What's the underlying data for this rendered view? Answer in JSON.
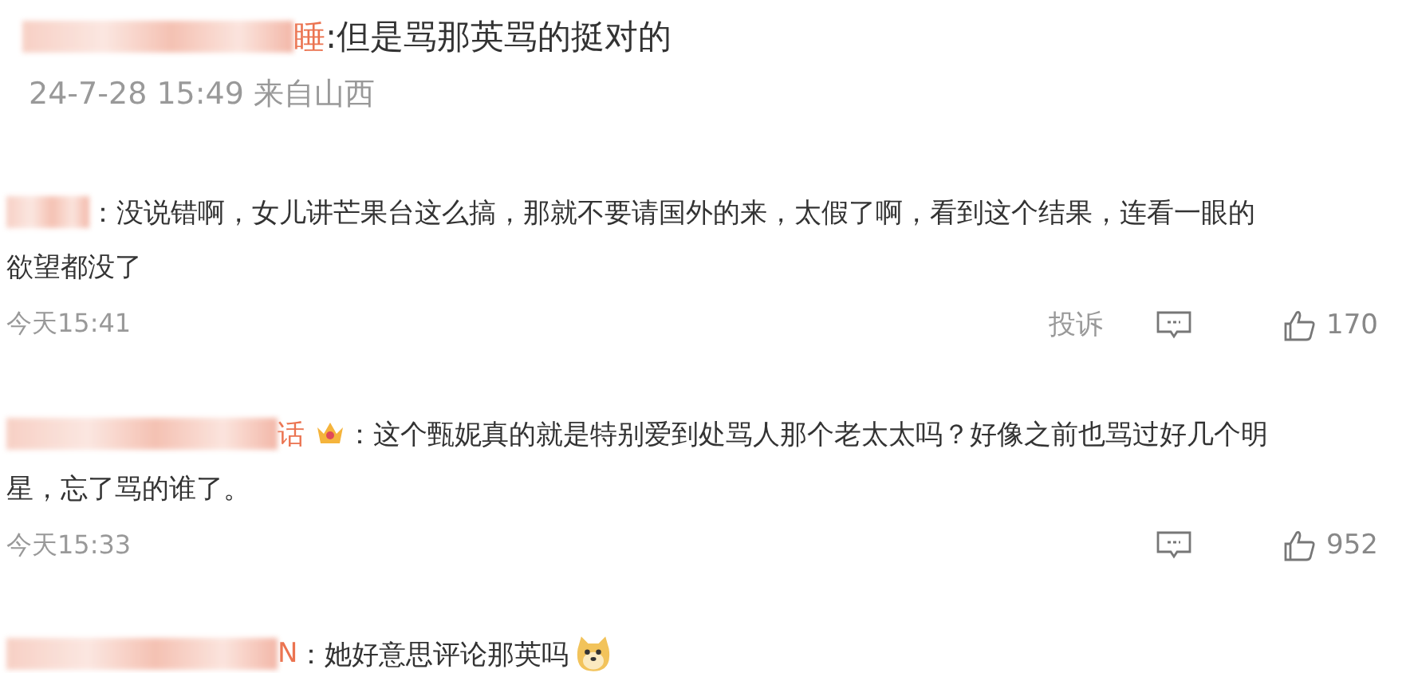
{
  "quoted_reply": {
    "name_tail": "睡",
    "text": ":但是骂那英骂的挺对的",
    "meta": "24-7-28 15:49 来自山西"
  },
  "comments": [
    {
      "text_lines": [
        "：没说错啊，女儿讲芒果台这么搞，那就不要请国外的来，太假了啊，看到这个结果，连看一眼的",
        "欲望都没了"
      ],
      "time": "今天15:41",
      "report": "投诉",
      "likes": "170"
    },
    {
      "name_tail": "话",
      "has_badge": true,
      "text_lines": [
        "：这个甄妮真的就是特别爱到处骂人那个老太太吗？好像之前也骂过好几个明",
        "星，忘了骂的谁了。"
      ],
      "time": "今天15:33",
      "likes": "952"
    },
    {
      "name_tail": "N",
      "text_lines": [
        "：她好意思评论那英吗"
      ],
      "has_emoji": true
    }
  ]
}
